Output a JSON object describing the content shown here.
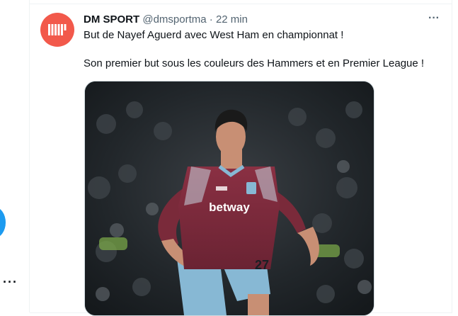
{
  "tweet": {
    "author_name": "DM SPORT",
    "author_handle": "@dmsportma",
    "separator": "·",
    "time": "22 min",
    "more_glyph": "···",
    "line1": "But de Nayef Aguerd avec West Ham en championnat !",
    "line2": "Son premier but sous les couleurs des Hammers et en Premier League !",
    "media": {
      "jersey_sponsor": "betway",
      "shirt_number": "27"
    }
  },
  "left_rail": {
    "more_glyph": "···"
  },
  "colors": {
    "avatar_bg": "#f2594b",
    "accent_blue": "#1d9bf0",
    "jersey_claret": "#7a2a3a",
    "shorts_sky": "#87b8d4"
  },
  "icons": {
    "avatar": "dm-sport-logo-icon",
    "more": "more-icon"
  }
}
